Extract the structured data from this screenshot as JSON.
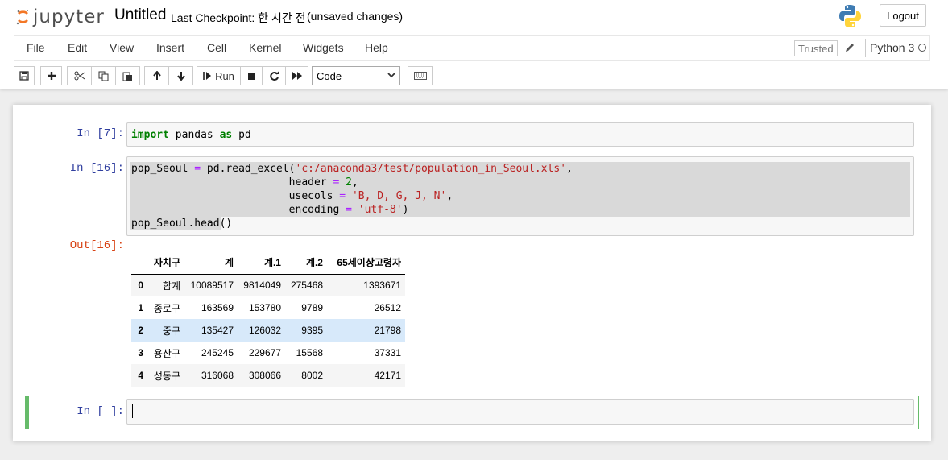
{
  "header": {
    "logo_text": "jupyter",
    "notebook_title": "Untitled",
    "checkpoint": "Last Checkpoint: 한 시간 전",
    "save_status": "(unsaved changes)",
    "logout_label": "Logout"
  },
  "menubar": {
    "items": [
      "File",
      "Edit",
      "View",
      "Insert",
      "Cell",
      "Kernel",
      "Widgets",
      "Help"
    ],
    "trusted_label": "Trusted",
    "kernel_name": "Python 3"
  },
  "toolbar": {
    "run_label": "Run",
    "cell_type": "Code",
    "buttons": [
      "save-icon",
      "plus-icon",
      "cut-icon",
      "copy-icon",
      "paste-icon",
      "arrow-up-icon",
      "arrow-down-icon",
      "run-icon",
      "stop-icon",
      "restart-icon",
      "fast-forward-icon",
      "keyboard-icon"
    ]
  },
  "cells": [
    {
      "prompt": "In [7]:",
      "code_lines": [
        "import pandas as pd"
      ]
    },
    {
      "prompt": "In [16]:",
      "code_lines": [
        "pop_Seoul = pd.read_excel('c:/anaconda3/test/population_in_Seoul.xls',",
        "                         header = 2,",
        "                         usecols = 'B, D, G, J, N',",
        "                         encoding = 'utf-8')",
        "pop_Seoul.head()"
      ],
      "output_prompt": "Out[16]:",
      "table": {
        "columns": [
          "",
          "자치구",
          "계",
          "계.1",
          "계.2",
          "65세이상고령자"
        ],
        "rows": [
          [
            "0",
            "합계",
            "10089517",
            "9814049",
            "275468",
            "1393671"
          ],
          [
            "1",
            "종로구",
            "163569",
            "153780",
            "9789",
            "26512"
          ],
          [
            "2",
            "중구",
            "135427",
            "126032",
            "9395",
            "21798"
          ],
          [
            "3",
            "용산구",
            "245245",
            "229677",
            "15568",
            "37331"
          ],
          [
            "4",
            "성동구",
            "316068",
            "308066",
            "8002",
            "42171"
          ]
        ]
      }
    },
    {
      "prompt": "In [ ]:",
      "code_lines": [
        ""
      ]
    }
  ],
  "colors": {
    "in_prompt": "#303f9f",
    "out_prompt": "#d84315",
    "selected_cell_border": "#66bb6a",
    "row_hover": "#d7e9fa"
  }
}
